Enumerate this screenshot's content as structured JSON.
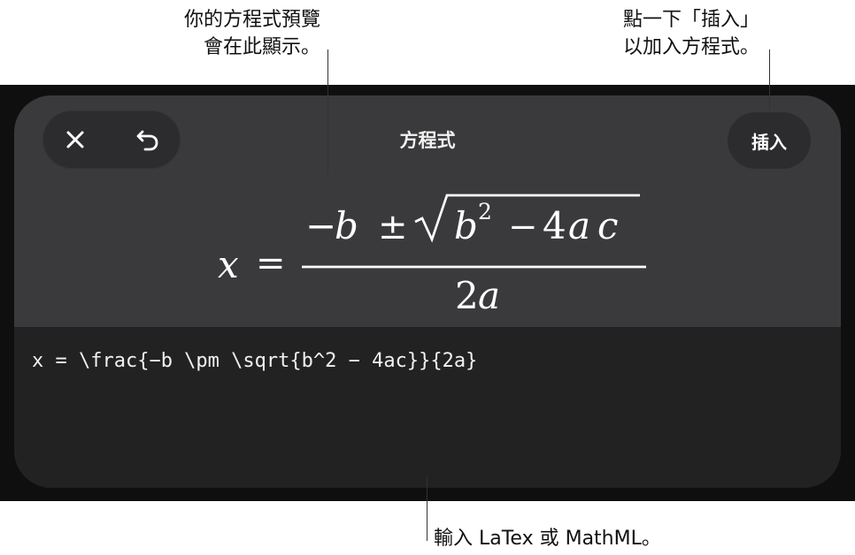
{
  "callouts": {
    "preview_line1": "你的方程式預覽",
    "preview_line2": "會在此顯示。",
    "insert_line1": "點一下「插入」",
    "insert_line2": "以加入方程式。",
    "latex_note": "輸入 LaTex 或 MathML。"
  },
  "editor": {
    "title": "方程式",
    "insert_label": "插入",
    "latex_value": "x = \\frac{−b \\pm \\sqrt{b^2 − 4ac}}{2a}",
    "icons": {
      "close": "close-icon",
      "undo": "undo-icon"
    }
  },
  "preview": {
    "lhs": "x",
    "equals": "=",
    "numerator_minus": "−",
    "numerator_b": "b",
    "plus_minus": "±",
    "radicand_b": "b",
    "exponent": "2",
    "radicand_minus": "−",
    "radicand_4": "4",
    "radicand_a": "a",
    "radicand_c": "c",
    "denominator_2": "2",
    "denominator_a": "a"
  },
  "colors": {
    "panel_top": "#3a3a3c",
    "panel_bottom": "#222223",
    "button_bg": "#2c2c2e",
    "text_light": "#ffffff"
  }
}
